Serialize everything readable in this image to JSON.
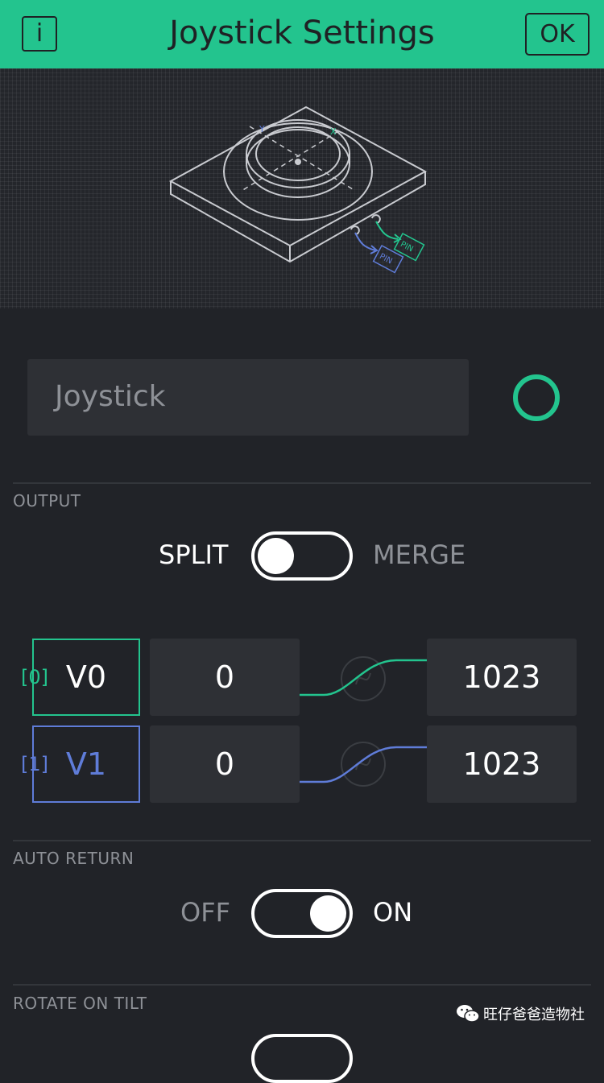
{
  "header": {
    "title": "Joystick Settings",
    "info_label": "i",
    "ok_label": "OK",
    "background": "#23c48e"
  },
  "illustration": {
    "axis_y": "Y",
    "axis_x": "X",
    "pin_label_green": "PIN",
    "pin_label_blue": "PIN"
  },
  "name_field": {
    "value": "Joystick",
    "color": "#23c48e"
  },
  "output": {
    "section_label": "OUTPUT",
    "left_label": "SPLIT",
    "right_label": "MERGE",
    "state": "SPLIT"
  },
  "pins": [
    {
      "index": "[0]",
      "pin": "V0",
      "min": "0",
      "max": "1023",
      "color": "#23c48e"
    },
    {
      "index": "[1]",
      "pin": "V1",
      "min": "0",
      "max": "1023",
      "color": "#5f7cd8"
    }
  ],
  "auto_return": {
    "section_label": "AUTO RETURN",
    "off_label": "OFF",
    "on_label": "ON",
    "state": "ON"
  },
  "rotate_on_tilt": {
    "section_label": "ROTATE ON TILT"
  },
  "watermark": {
    "text": "旺仔爸爸造物社",
    "icon": "wechat-icon"
  }
}
